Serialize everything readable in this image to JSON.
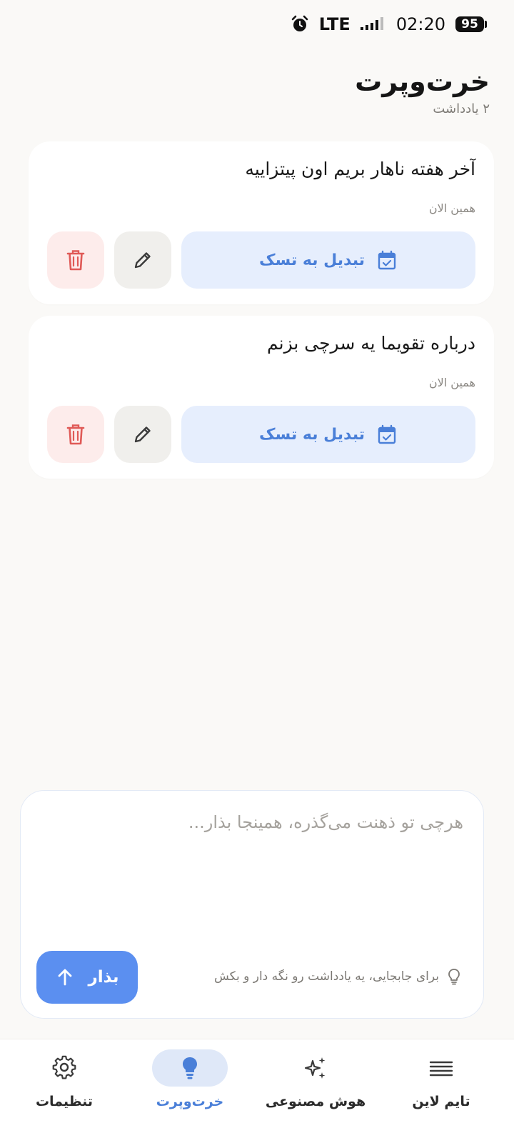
{
  "status_bar": {
    "network": "LTE",
    "time": "02:20",
    "battery": "95"
  },
  "header": {
    "title": "خرت‌وپرت",
    "count": "۲ یادداشت"
  },
  "notes": [
    {
      "text": "آخر هفته ناهار بریم اون پیتزاییه",
      "time": "همین الان",
      "convert_label": "تبدیل به تسک"
    },
    {
      "text": "درباره تقویما یه سرچی بزنم",
      "time": "همین الان",
      "convert_label": "تبدیل به تسک"
    }
  ],
  "composer": {
    "placeholder": "هرچی تو ذهنت می‌گذره، همینجا بذار...",
    "hint": "برای جابجایی، یه یادداشت رو نگه دار و بکش",
    "submit_label": "بذار"
  },
  "bottom_nav": {
    "items": [
      {
        "label": "تایم لاین",
        "icon": "timeline-icon"
      },
      {
        "label": "هوش مصنوعی",
        "icon": "sparkles-icon"
      },
      {
        "label": "خرت‌وپرت",
        "icon": "lightbulb-icon",
        "active": true
      },
      {
        "label": "تنظیمات",
        "icon": "gear-icon"
      }
    ]
  },
  "colors": {
    "accent": "#5b8ff0",
    "accent_soft": "#e6eefd",
    "danger": "#e05a57",
    "background": "#faf9f7"
  }
}
